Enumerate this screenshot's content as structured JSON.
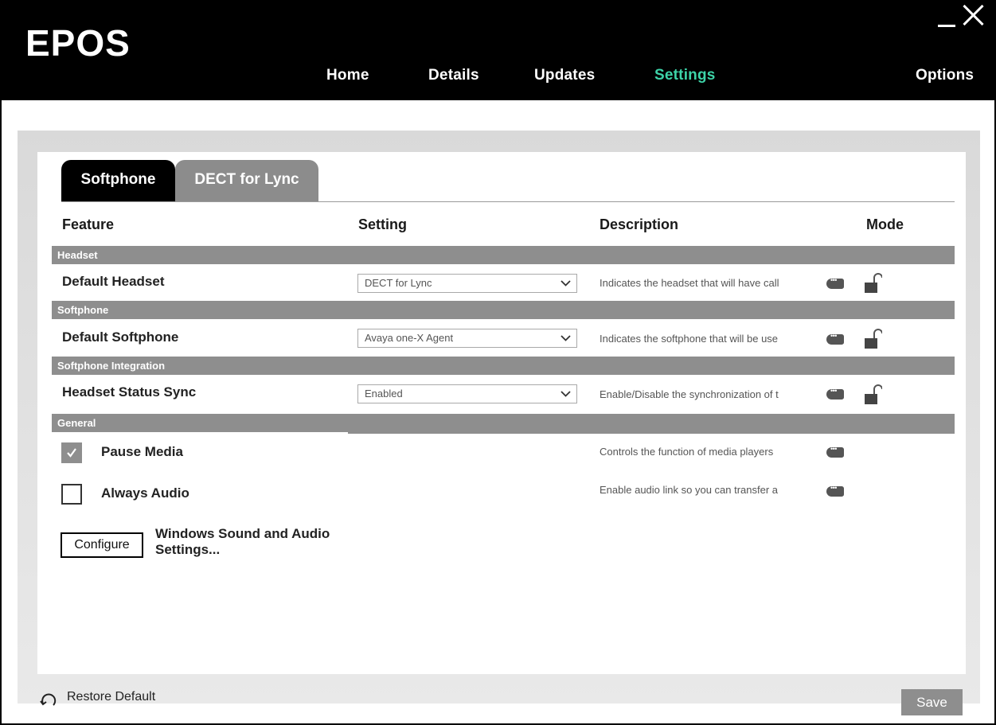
{
  "app": {
    "logo_text": "EPOS"
  },
  "nav": {
    "home": "Home",
    "details": "Details",
    "updates": "Updates",
    "settings": "Settings",
    "options": "Options",
    "active": "settings",
    "active_color": "#3dd3a8"
  },
  "tabs": [
    {
      "label": "Softphone",
      "active": true
    },
    {
      "label": "DECT for Lync",
      "active": false
    }
  ],
  "columns": {
    "feature": "Feature",
    "setting": "Setting",
    "description": "Description",
    "mode": "Mode"
  },
  "sections": [
    {
      "title": "Headset",
      "row": {
        "label": "Default Headset",
        "value": "DECT for Lync",
        "description": "Indicates the headset that will have call",
        "mode_icon": "unlocked-padlock-icon"
      }
    },
    {
      "title": "Softphone",
      "row": {
        "label": "Default Softphone",
        "value": "Avaya one-X Agent",
        "description": "Indicates the softphone that will be use",
        "mode_icon": "unlocked-padlock-icon"
      }
    },
    {
      "title": "Softphone Integration",
      "row": {
        "label": "Headset Status Sync",
        "value": "Enabled",
        "description": "Enable/Disable the synchronization of t",
        "mode_icon": "unlocked-padlock-icon"
      }
    },
    {
      "title": "General"
    }
  ],
  "general": {
    "pause_media": {
      "label": "Pause Media",
      "checked": true,
      "description": "Controls the function of media players"
    },
    "always_audio": {
      "label": "Always Audio",
      "checked": false,
      "description": "Enable audio link so you can transfer a"
    },
    "configure": {
      "button": "Configure",
      "text": "Windows Sound and Audio Settings..."
    }
  },
  "footer": {
    "restore": "Restore Default",
    "save": "Save"
  }
}
